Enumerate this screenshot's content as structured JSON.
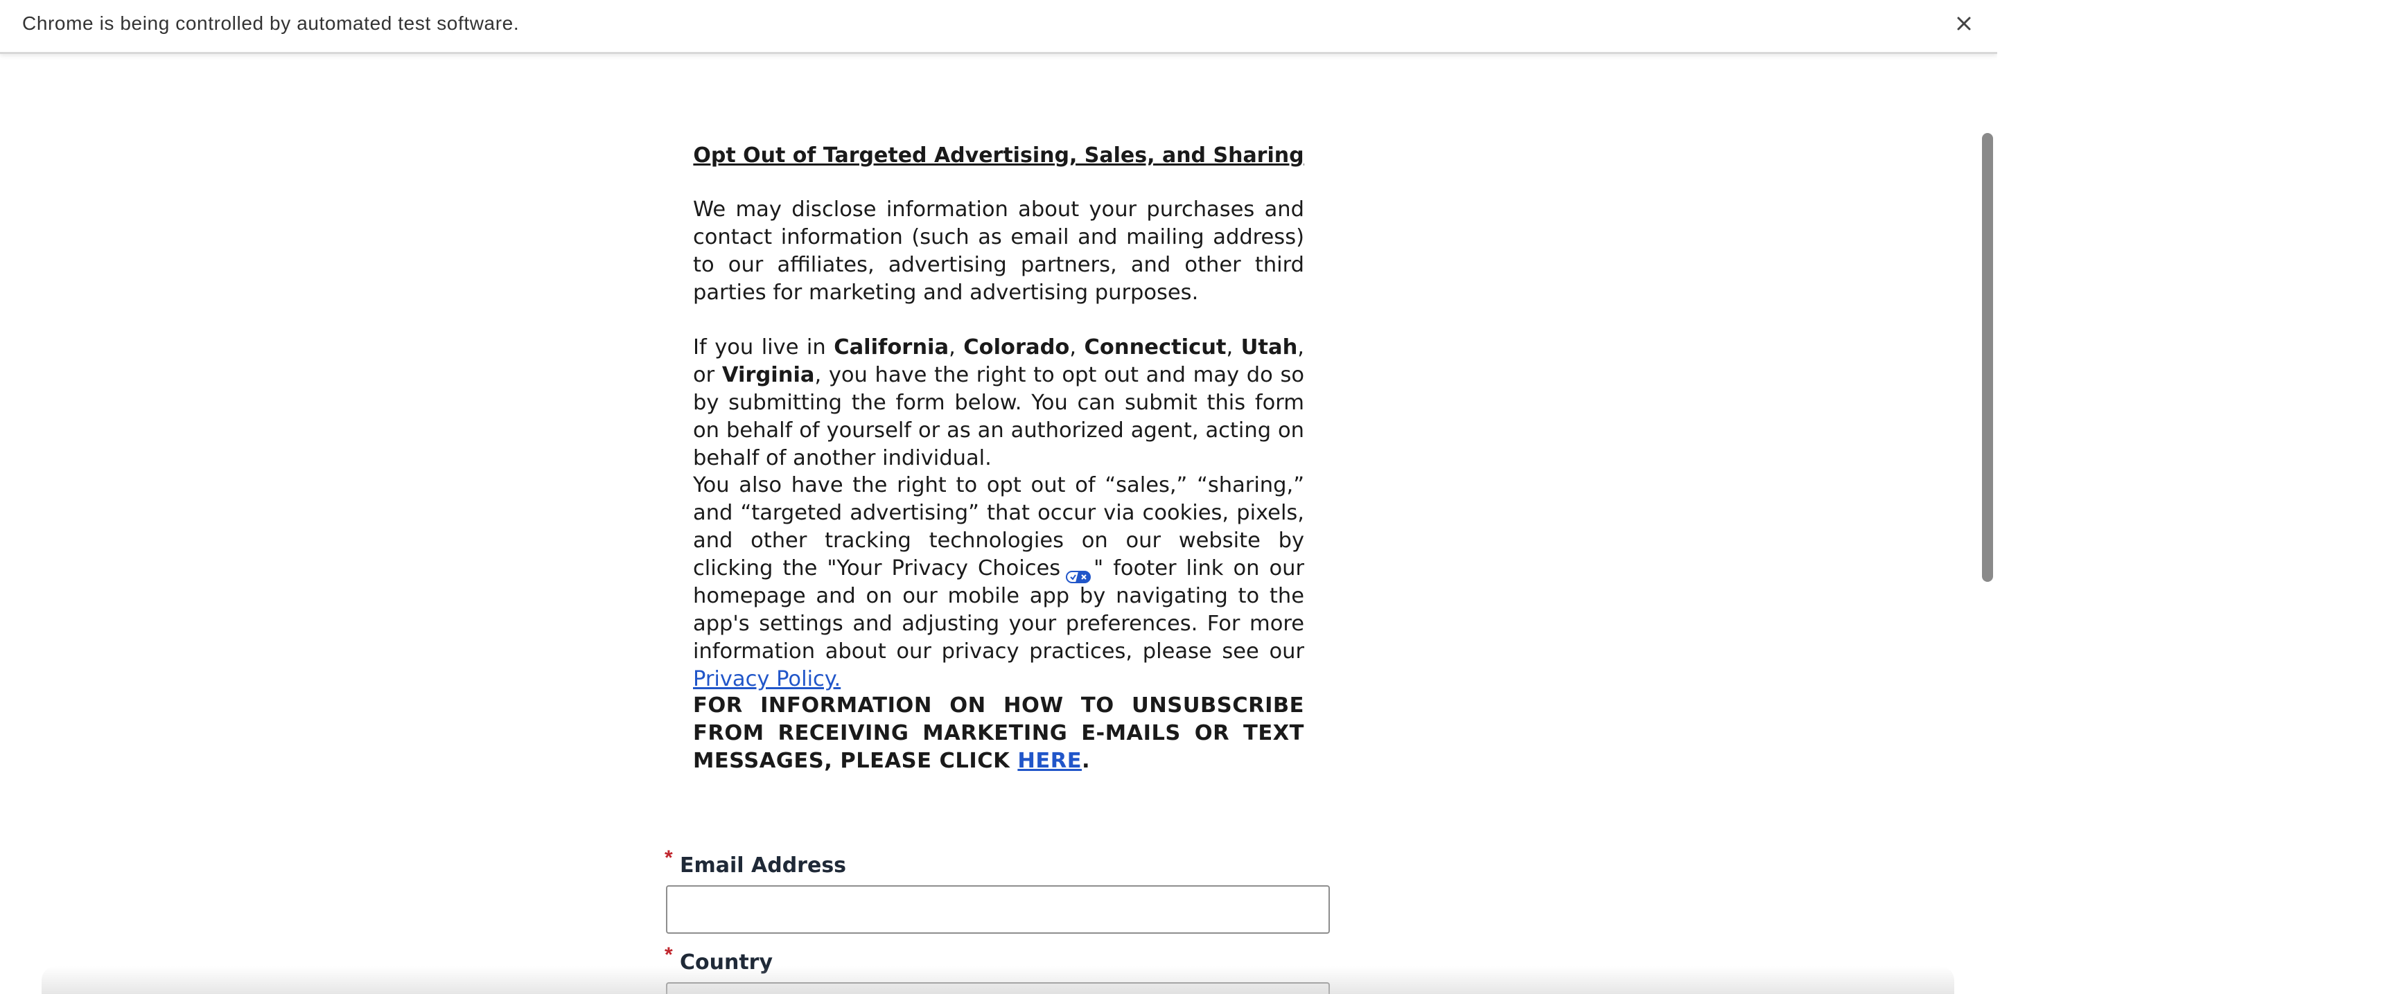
{
  "infobar": {
    "message": "Chrome is being controlled by automated test software.",
    "close_icon": "close-icon"
  },
  "article": {
    "title": "Opt Out of Targeted Advertising, Sales, and Sharing",
    "p1": "We may disclose information about your purchases and contact information (such as email and mailing address) to our affiliates, advertising partners, and other third parties for marketing and advertising purposes.",
    "p2": {
      "lead": "If you live in ",
      "states": [
        "California",
        "Colorado",
        "Connecticut",
        "Utah",
        "Virginia"
      ],
      "sep": ", ",
      "or": ", or ",
      "rest": ", you have the right to opt out and may do so by submitting the form below. You can submit this form on behalf of yourself or as an authorized agent, acting on behalf of another individual."
    },
    "p3": {
      "part1": "You also have the right to opt out of “sales,” “sharing,” and “targeted advertising” that occur via cookies, pixels, and other tracking technologies on our website by clicking the \"Your Privacy Choices",
      "toggle_icon": "privacy-choices-toggle-icon",
      "part2": "\" footer link on our homepage and on our mobile app by navigating to the app's settings and adjusting your preferences. For more information about our privacy practices, please see our ",
      "privacy_link": "Privacy Policy."
    },
    "p4": {
      "text": "FOR INFORMATION ON HOW TO UNSUBSCRIBE FROM RECEIVING MARKETING E-MAILS OR TEXT MESSAGES, PLEASE CLICK ",
      "link": "HERE",
      "end": "."
    }
  },
  "form": {
    "required_mark": "*",
    "email_label": "Email Address",
    "email_value": "",
    "country_label": "Country",
    "country_value": ""
  },
  "colors": {
    "link": "#2156c9",
    "required": "#c0262d",
    "scrollbar": "#8a8a8a"
  }
}
